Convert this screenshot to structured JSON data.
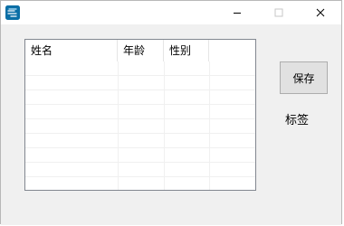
{
  "window": {
    "icon": "app-icon",
    "controls": {
      "minimize_icon": "minimize-icon",
      "maximize_icon": "maximize-icon",
      "close_icon": "close-icon"
    }
  },
  "listview": {
    "columns": [
      "姓名",
      "年龄",
      "性别"
    ],
    "rows": []
  },
  "save_button": {
    "label": "保存"
  },
  "label": {
    "text": "标签"
  },
  "colors": {
    "window_bg": "#f0f0f0",
    "titlebar_bg": "#ffffff",
    "border": "#828790",
    "button_bg": "#e1e1e1",
    "button_border": "#adadad"
  }
}
